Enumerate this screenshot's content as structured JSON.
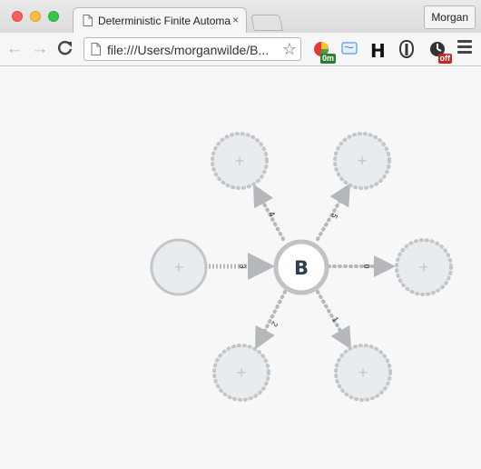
{
  "browser": {
    "tab": {
      "title": "Deterministic Finite Automa",
      "close": "×"
    },
    "profile_name": "Morgan",
    "address_bar": {
      "url": "file:///Users/morganwilde/B..."
    },
    "nav": {
      "back": "←",
      "forward": "→",
      "reload": "C"
    },
    "extensions": [
      {
        "name": "timer-extension-icon",
        "badge": "0m",
        "badge_color": "#2e7d32"
      },
      {
        "name": "folder-extension-icon",
        "badge": ""
      },
      {
        "name": "h-extension-icon",
        "label": "H"
      },
      {
        "name": "shield-extension-icon",
        "badge": ""
      },
      {
        "name": "clock-extension-icon",
        "badge": "off",
        "badge_color": "#c62828"
      }
    ]
  },
  "automaton": {
    "center_state": {
      "label": "B"
    },
    "add_symbol": "+",
    "transitions": [
      {
        "symbol": "0",
        "direction": "outgoing"
      },
      {
        "symbol": "1",
        "direction": "outgoing"
      },
      {
        "symbol": "2",
        "direction": "outgoing"
      },
      {
        "symbol": "3",
        "direction": "incoming"
      },
      {
        "symbol": "4",
        "direction": "outgoing"
      },
      {
        "symbol": "5",
        "direction": "outgoing"
      }
    ]
  }
}
